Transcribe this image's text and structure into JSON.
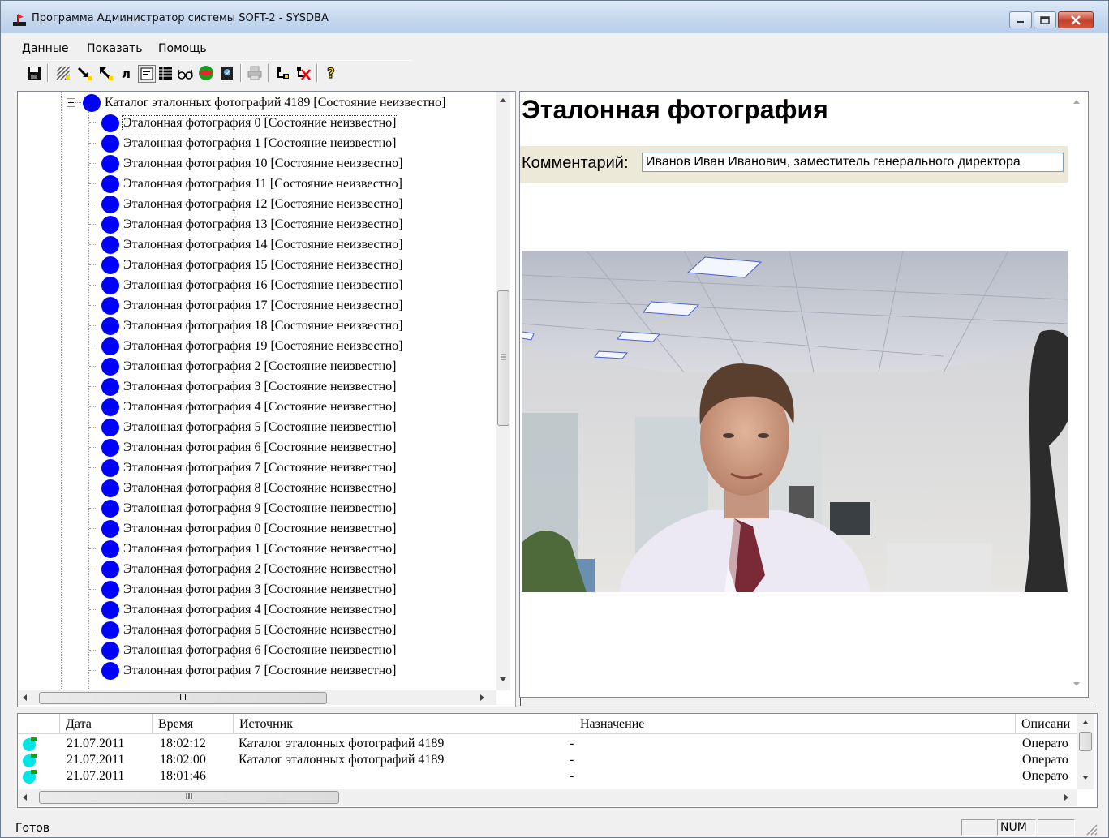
{
  "window": {
    "title": "Программа Администратор системы SOFT-2 - SYSDBA"
  },
  "menu": [
    "Данные",
    "Показать",
    "Помощь"
  ],
  "toolbar": {
    "icons": [
      "save-icon",
      "pattern-icon",
      "arrow-down-icon",
      "arrow-up-icon",
      "lambda-icon",
      "form-icon",
      "grid-icon",
      "glasses-icon",
      "ball-icon",
      "book-icon",
      "print-icon",
      "connect-icon",
      "disconnect-icon",
      "help-icon"
    ]
  },
  "tree": {
    "root": "Каталог эталонных фотографий 4189 [Состояние неизвестно]",
    "items": [
      "Эталонная фотография 0 [Состояние неизвестно]",
      "Эталонная фотография 1 [Состояние неизвестно]",
      "Эталонная фотография 10 [Состояние неизвестно]",
      "Эталонная фотография 11 [Состояние неизвестно]",
      "Эталонная фотография 12 [Состояние неизвестно]",
      "Эталонная фотография 13 [Состояние неизвестно]",
      "Эталонная фотография 14 [Состояние неизвестно]",
      "Эталонная фотография 15 [Состояние неизвестно]",
      "Эталонная фотография 16 [Состояние неизвестно]",
      "Эталонная фотография 17 [Состояние неизвестно]",
      "Эталонная фотография 18 [Состояние неизвестно]",
      "Эталонная фотография 19 [Состояние неизвестно]",
      "Эталонная фотография 2 [Состояние неизвестно]",
      "Эталонная фотография 3 [Состояние неизвестно]",
      "Эталонная фотография 4 [Состояние неизвестно]",
      "Эталонная фотография 5 [Состояние неизвестно]",
      "Эталонная фотография 6 [Состояние неизвестно]",
      "Эталонная фотография 7 [Состояние неизвестно]",
      "Эталонная фотография 8 [Состояние неизвестно]",
      "Эталонная фотография 9 [Состояние неизвестно]",
      "Эталонная фотография 0 [Состояние неизвестно]",
      "Эталонная фотография 1 [Состояние неизвестно]",
      "Эталонная фотография 2 [Состояние неизвестно]",
      "Эталонная фотография 3 [Состояние неизвестно]",
      "Эталонная фотография 4 [Состояние неизвестно]",
      "Эталонная фотография 5 [Состояние неизвестно]",
      "Эталонная фотография 6 [Состояние неизвестно]",
      "Эталонная фотография 7 [Состояние неизвестно]"
    ],
    "selected_index": 0,
    "hscroll_label": "III",
    "colors": {
      "node": "#0000ff"
    }
  },
  "detail": {
    "title": "Эталонная фотография",
    "comment_label": "Комментарий:",
    "comment_value": "Иванов Иван Иванович, заместитель генерального директора"
  },
  "log": {
    "columns": [
      "",
      "Дата",
      "Время",
      "Источник",
      "Назначение",
      "Описани"
    ],
    "rows": [
      {
        "date": "21.07.2011",
        "time": "18:02:12",
        "source": "Каталог эталонных фотографий 4189",
        "dest": "-",
        "desc": "Операто"
      },
      {
        "date": "21.07.2011",
        "time": "18:02:00",
        "source": "Каталог эталонных фотографий 4189",
        "dest": "-",
        "desc": "Операто"
      },
      {
        "date": "21.07.2011",
        "time": "18:01:46",
        "source": "",
        "dest": "-",
        "desc": "Операто"
      }
    ],
    "hscroll_label": "III",
    "colors": {
      "status_icon": "#00e5e5"
    }
  },
  "status": {
    "text": "Готов",
    "num": "NUM"
  }
}
